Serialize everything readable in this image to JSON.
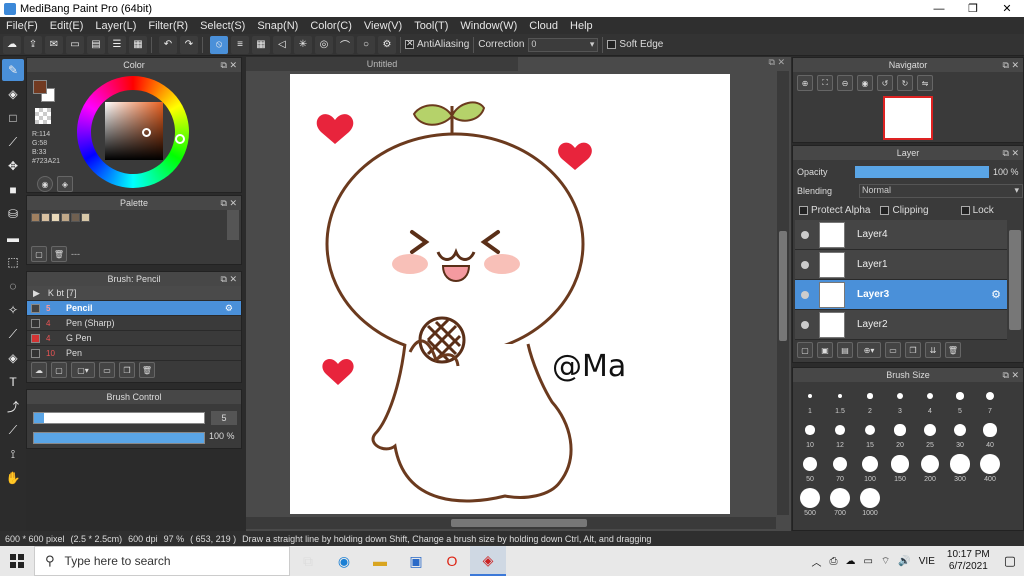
{
  "window": {
    "title": "MediBang Paint Pro (64bit)",
    "minimize": "—",
    "maximize": "❐",
    "close": "✕"
  },
  "menu": [
    "File(F)",
    "Edit(E)",
    "Layer(L)",
    "Filter(R)",
    "Select(S)",
    "Snap(N)",
    "Color(C)",
    "View(V)",
    "Tool(T)",
    "Window(W)",
    "Cloud",
    "Help"
  ],
  "toolbar": {
    "antialiasing_label": "AntiAliasing",
    "correction_label": "Correction",
    "correction_value": "0",
    "soft_edge_label": "Soft Edge"
  },
  "color_panel": {
    "title": "Color",
    "r": "R:114",
    "g": "G:58",
    "b": "B:33",
    "hex": "#723A21",
    "primary_color": "#723A21",
    "secondary_color": "#ffffff"
  },
  "palette_panel": {
    "title": "Palette",
    "swatches": [
      "#a08060",
      "#d8c0a0",
      "#e8d8b8",
      "#c0a888",
      "#706050",
      "#d8c8a8"
    ],
    "label": "---"
  },
  "brush_panel": {
    "title": "Brush: Pencil",
    "group": "K bt [7]",
    "items": [
      {
        "num": "5",
        "name": "Pencil",
        "selected": true,
        "swatch": "#444444"
      },
      {
        "num": "4",
        "name": "Pen (Sharp)",
        "selected": false,
        "swatch": "#333333"
      },
      {
        "num": "4",
        "name": "G Pen",
        "selected": false,
        "swatch": "#d33333"
      },
      {
        "num": "10",
        "name": "Pen",
        "selected": false,
        "swatch": "#333333"
      }
    ]
  },
  "brush_control": {
    "title": "Brush Control",
    "size": "5",
    "size_fraction": 0.06,
    "opacity": "100 %",
    "opacity_fraction": 1.0
  },
  "canvas": {
    "tab_title": "Untitled",
    "signature": "@Ma"
  },
  "navigator": {
    "title": "Navigator"
  },
  "layer_panel": {
    "title": "Layer",
    "opacity_label": "Opacity",
    "opacity_value": "100 %",
    "opacity_fraction": 1.0,
    "blending_label": "Blending",
    "blending_value": "Normal",
    "protect_alpha": "Protect Alpha",
    "clipping": "Clipping",
    "lock": "Lock",
    "layers": [
      {
        "name": "Layer4",
        "selected": false
      },
      {
        "name": "Layer1",
        "selected": false
      },
      {
        "name": "Layer3",
        "selected": true
      },
      {
        "name": "Layer2",
        "selected": false
      }
    ]
  },
  "brush_size_panel": {
    "title": "Brush Size",
    "sizes": [
      "1",
      "1.5",
      "2",
      "3",
      "4",
      "5",
      "7",
      "10",
      "12",
      "15",
      "20",
      "25",
      "30",
      "40",
      "50",
      "70",
      "100",
      "150",
      "200",
      "300",
      "400",
      "500",
      "700",
      "1000"
    ]
  },
  "status": {
    "size": "600 * 600 pixel",
    "physical": "(2.5 * 2.5cm)",
    "dpi": "600 dpi",
    "zoom": "97 %",
    "coords": "( 653, 219 )",
    "hint": "Draw a straight line by holding down Shift, Change a brush size by holding down Ctrl, Alt, and dragging"
  },
  "taskbar": {
    "search_placeholder": "Type here to search",
    "lang": "VIE",
    "time": "10:17 PM",
    "date": "6/7/2021"
  }
}
